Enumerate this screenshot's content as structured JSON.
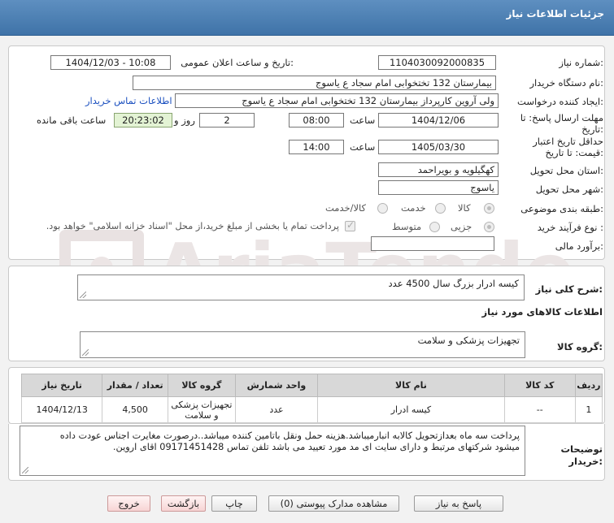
{
  "header": {
    "title": "جزئیات اطلاعات نیاز"
  },
  "form": {
    "need_number_label": "شماره نیاز:",
    "need_number": "1104030092000835",
    "announce_label": "تاریخ و ساعت اعلان عمومی:",
    "announce_value": "1404/12/03 - 10:08",
    "buyer_org_label": "نام دستگاه خریدار:",
    "buyer_org": "بیمارستان 132 تختخوابی امام سجاد  ع  یاسوج",
    "creator_label": "ایجاد کننده درخواست:",
    "creator": "ولی آروین کارپرداز بیمارستان 132 تختخوابی امام سجاد  ع  یاسوج",
    "contact_link": "اطلاعات تماس خریدار",
    "deadline_label": "مهلت ارسال پاسخ: تا تاریخ:",
    "deadline_date": "1404/12/06",
    "time_label": "ساعت",
    "deadline_time": "08:00",
    "days_count": "2",
    "days_label": "روز و",
    "remaining_time": "20:23:02",
    "remaining_label": "ساعت باقی مانده",
    "validity_label": "حداقل تاریخ اعتبار قیمت: تا تاریخ:",
    "validity_date": "1405/03/30",
    "validity_time": "14:00",
    "province_label": "استان محل تحویل:",
    "province": "کهگیلویه و بویراحمد",
    "city_label": "شهر محل تحویل:",
    "city": "یاسوج",
    "category_label": "طبقه بندی موضوعی:",
    "category_options": [
      "کالا",
      "خدمت",
      "کالا/خدمت"
    ],
    "process_label": "نوع فرآیند خرید :",
    "process_options": [
      "جزیی",
      "متوسط"
    ],
    "payment_note": "پرداخت تمام یا بخشی از مبلغ خرید،از محل \"اسناد خزانه اسلامی\" خواهد بود.",
    "budget_label": "برآورد مالی:",
    "budget_value": ""
  },
  "summary": {
    "label": "شرح کلی نیاز:",
    "text": "کیسه ادرار بزرگ سال 4500 عدد"
  },
  "goods": {
    "section_title": "اطلاعات کالاهای مورد نیاز",
    "group_label": "گروه کالا:",
    "group_value": "تجهیزات پزشکی و سلامت",
    "columns": {
      "row": "ردیف",
      "code": "کد کالا",
      "name": "نام کالا",
      "unit": "واحد شمارش",
      "group": "گروه کالا",
      "qty": "تعداد / مقدار",
      "date": "تاریخ نیاز"
    },
    "rows": [
      {
        "row": "1",
        "code": "--",
        "name": "کیسه ادرار",
        "unit": "عدد",
        "group": "تجهیزات پزشکی و سلامت",
        "qty": "4,500",
        "date": "1404/12/13"
      }
    ]
  },
  "notes": {
    "label": "توضیحات خریدار:",
    "line1": "پرداخت سه ماه بعدازتحویل کالابه انبارمیباشد.هزینه حمل ونقل باتامین کننده میباشد..درصورت مغایرت اجناس عودت داده",
    "line2": "میشود شرکتهای مرتبط  و دارای سایت ای مد مورد تعیید می باشد  تلفن تماس 09171451428 اقای اروین."
  },
  "buttons": {
    "reply": "پاسخ به نیاز",
    "attachments": "مشاهده مدارک پیوستی (0)",
    "print": "چاپ",
    "back": "بازگشت",
    "exit": "خروج"
  }
}
